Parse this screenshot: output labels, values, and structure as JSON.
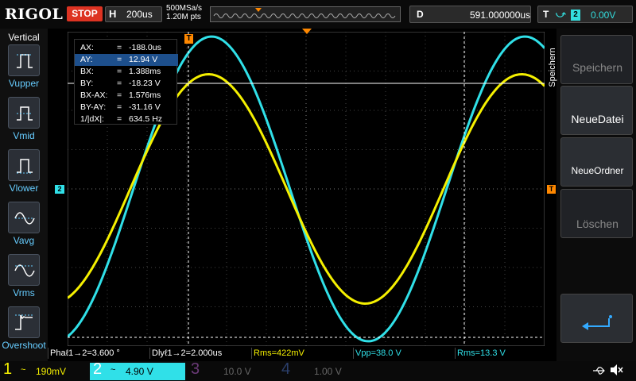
{
  "brand": {
    "logo": "RIGOL"
  },
  "status": {
    "run_state": "STOP"
  },
  "timebase": {
    "label": "H",
    "value": "200us"
  },
  "acquisition": {
    "sample_rate": "500MSa/s",
    "memory_depth": "1.20M pts"
  },
  "delay": {
    "label": "D",
    "value": "591.000000us"
  },
  "trigger": {
    "label": "T",
    "edge_icon": "rising-edge-icon",
    "source": "2",
    "level": "0.00V"
  },
  "vertical_menu": {
    "title": "Vertical",
    "items": [
      {
        "label": "Vupper",
        "icon": "vupper-icon"
      },
      {
        "label": "Vmid",
        "icon": "vmid-icon"
      },
      {
        "label": "Vlower",
        "icon": "vlower-icon"
      },
      {
        "label": "Vavg",
        "icon": "vavg-icon"
      },
      {
        "label": "Vrms",
        "icon": "vrms-icon"
      },
      {
        "label": "Overshoot",
        "icon": "overshoot-icon"
      }
    ]
  },
  "cursor_readout": {
    "rows": [
      {
        "name": "AX:",
        "eq": "=",
        "value": "-188.0us"
      },
      {
        "name": "AY:",
        "eq": "=",
        "value": "12.94 V"
      },
      {
        "name": "BX:",
        "eq": "=",
        "value": "1.388ms"
      },
      {
        "name": "BY:",
        "eq": "=",
        "value": "-18.23 V"
      },
      {
        "name": "BX-AX:",
        "eq": "=",
        "value": "1.576ms"
      },
      {
        "name": "BY-AY:",
        "eq": "=",
        "value": "-31.16 V"
      },
      {
        "name": "1/|dX|:",
        "eq": "=",
        "value": "634.5 Hz"
      }
    ],
    "selected_row": 1
  },
  "markers": {
    "trigger_marker": "T",
    "ch2_marker": "2"
  },
  "waveforms": {
    "ch1": {
      "color": "#f5f000",
      "amplitude_v": 11.0
    },
    "ch2": {
      "color": "#30e0e8",
      "amplitude_v": 19.0
    },
    "frequency_hz": 634.5,
    "phase_offset_deg": 3.6
  },
  "side_menu": {
    "title": "Speichern",
    "buttons": [
      {
        "label": "Speichern",
        "enabled": false
      },
      {
        "label": "NeueDatei",
        "enabled": true
      },
      {
        "label": "NeueOrdner",
        "enabled": true
      },
      {
        "label": "Löschen",
        "enabled": false
      }
    ],
    "enter_icon": "return-arrow-icon"
  },
  "measurements": [
    {
      "label": "Phaℓ1→2=3.600 °",
      "color": "#ffffff"
    },
    {
      "label": "Dlyℓ1→2=2.000us",
      "color": "#ffffff"
    },
    {
      "label": "Rms=422mV",
      "color": "#f5f000"
    },
    {
      "label": "Vpp=38.0 V",
      "color": "#30e0e8"
    },
    {
      "label": "Rms=13.3 V",
      "color": "#30e0e8"
    }
  ],
  "channels": [
    {
      "num": "1",
      "coupling": "~",
      "scale": "190mV",
      "color": "#f5f000",
      "active": false
    },
    {
      "num": "2",
      "coupling": "~",
      "scale": "4.90 V",
      "color": "#30e0e8",
      "active": true
    },
    {
      "num": "3",
      "coupling": "",
      "scale": "10.0 V",
      "color": "#6b3a78",
      "active": false
    },
    {
      "num": "4",
      "coupling": "",
      "scale": "1.00 V",
      "color": "#2b3f6b",
      "active": false
    }
  ],
  "status_icons": {
    "usb": "usb-icon",
    "sound": "mute-icon"
  }
}
